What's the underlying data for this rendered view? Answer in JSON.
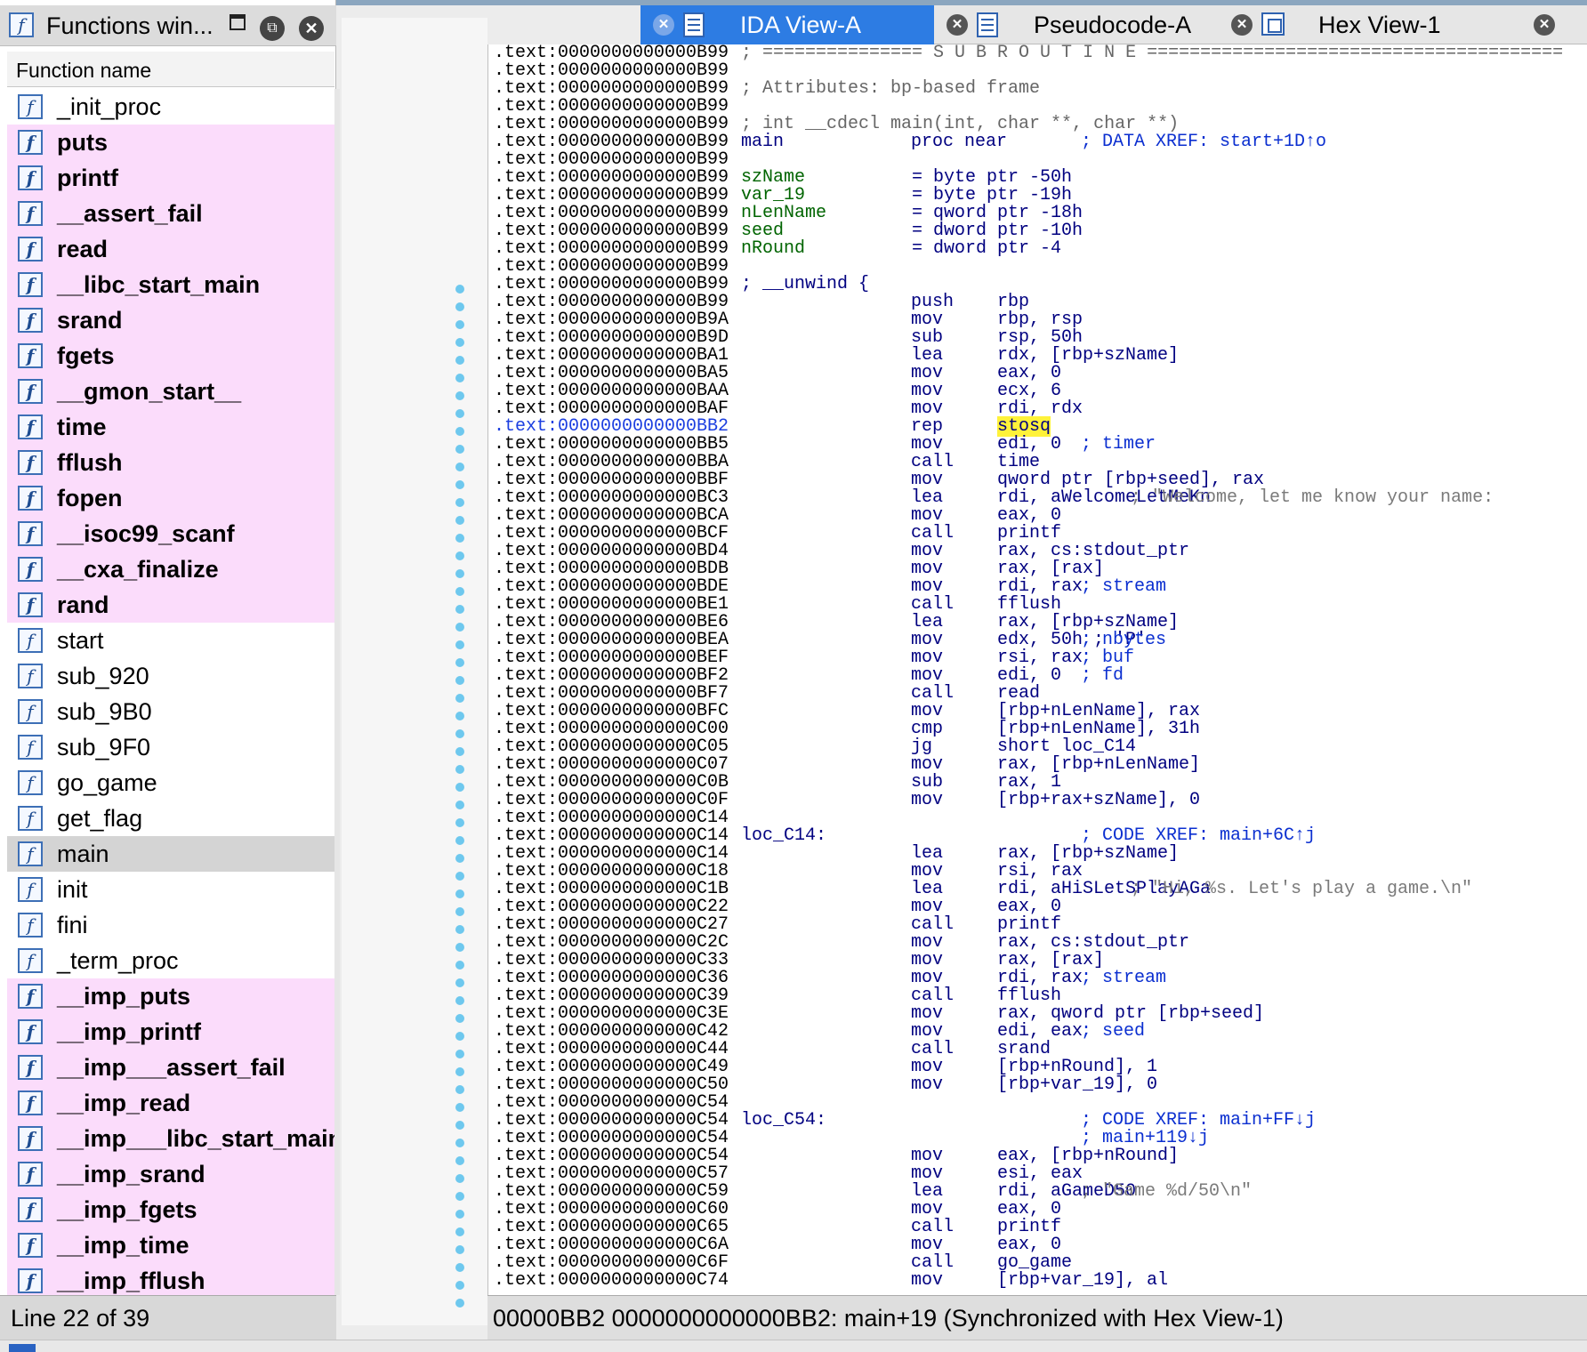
{
  "functions_window": {
    "title": "Functions win...",
    "header": "Function name",
    "status": "Line 22 of 39",
    "items": [
      {
        "name": "_init_proc",
        "lib": false,
        "selected": false
      },
      {
        "name": "puts",
        "lib": true,
        "selected": false
      },
      {
        "name": "printf",
        "lib": true,
        "selected": false
      },
      {
        "name": "__assert_fail",
        "lib": true,
        "selected": false
      },
      {
        "name": "read",
        "lib": true,
        "selected": false
      },
      {
        "name": "__libc_start_main",
        "lib": true,
        "selected": false
      },
      {
        "name": "srand",
        "lib": true,
        "selected": false
      },
      {
        "name": "fgets",
        "lib": true,
        "selected": false
      },
      {
        "name": "__gmon_start__",
        "lib": true,
        "selected": false
      },
      {
        "name": "time",
        "lib": true,
        "selected": false
      },
      {
        "name": "fflush",
        "lib": true,
        "selected": false
      },
      {
        "name": "fopen",
        "lib": true,
        "selected": false
      },
      {
        "name": "__isoc99_scanf",
        "lib": true,
        "selected": false
      },
      {
        "name": "__cxa_finalize",
        "lib": true,
        "selected": false
      },
      {
        "name": "rand",
        "lib": true,
        "selected": false
      },
      {
        "name": "start",
        "lib": false,
        "selected": false
      },
      {
        "name": "sub_920",
        "lib": false,
        "selected": false
      },
      {
        "name": "sub_9B0",
        "lib": false,
        "selected": false
      },
      {
        "name": "sub_9F0",
        "lib": false,
        "selected": false
      },
      {
        "name": "go_game",
        "lib": false,
        "selected": false
      },
      {
        "name": "get_flag",
        "lib": false,
        "selected": false
      },
      {
        "name": "main",
        "lib": false,
        "selected": true
      },
      {
        "name": "init",
        "lib": false,
        "selected": false
      },
      {
        "name": "fini",
        "lib": false,
        "selected": false
      },
      {
        "name": "_term_proc",
        "lib": false,
        "selected": false
      },
      {
        "name": "__imp_puts",
        "lib": true,
        "selected": false
      },
      {
        "name": "__imp_printf",
        "lib": true,
        "selected": false
      },
      {
        "name": "__imp___assert_fail",
        "lib": true,
        "selected": false
      },
      {
        "name": "__imp_read",
        "lib": true,
        "selected": false
      },
      {
        "name": "__imp___libc_start_main",
        "lib": true,
        "selected": false
      },
      {
        "name": "__imp_srand",
        "lib": true,
        "selected": false
      },
      {
        "name": "__imp_fgets",
        "lib": true,
        "selected": false
      },
      {
        "name": "__imp_time",
        "lib": true,
        "selected": false
      },
      {
        "name": "__imp_fflush",
        "lib": true,
        "selected": false
      }
    ]
  },
  "tabs": [
    {
      "label": "IDA View-A",
      "active": true,
      "icon": "ida-view-icon"
    },
    {
      "label": "Pseudocode-A",
      "active": false,
      "icon": "pseudocode-icon"
    },
    {
      "label": "Hex View-1",
      "active": false,
      "icon": "hex-view-icon"
    }
  ],
  "status": "00000BB2  0000000000000BB2: main+19  (Synchronized with Hex View-1)",
  "cursor_token": "stosq",
  "listing": [
    {
      "addr": ".text:0000000000000B99",
      "sep": "; =============== S U B R O U T I N E ======================================="
    },
    {
      "addr": ".text:0000000000000B99"
    },
    {
      "addr": ".text:0000000000000B99",
      "sep": "; Attributes: bp-based frame"
    },
    {
      "addr": ".text:0000000000000B99"
    },
    {
      "addr": ".text:0000000000000B99",
      "sep": "; int __cdecl main(int, char **, char **)"
    },
    {
      "addr": ".text:0000000000000B99",
      "label": "main",
      "mnem": "proc near",
      "cmt": "; DATA XREF: start+1D↑o",
      "cmtcol": 660
    },
    {
      "addr": ".text:0000000000000B99"
    },
    {
      "addr": ".text:0000000000000B99",
      "var": "szName",
      "eq": "= byte ptr -50h"
    },
    {
      "addr": ".text:0000000000000B99",
      "var": "var_19",
      "eq": "= byte ptr -19h"
    },
    {
      "addr": ".text:0000000000000B99",
      "var": "nLenName",
      "eq": "= qword ptr -18h"
    },
    {
      "addr": ".text:0000000000000B99",
      "var": "seed",
      "eq": "= dword ptr -10h"
    },
    {
      "addr": ".text:0000000000000B99",
      "var": "nRound",
      "eq": "= dword ptr -4"
    },
    {
      "addr": ".text:0000000000000B99"
    },
    {
      "addr": ".text:0000000000000B99",
      "label": "; __unwind {"
    },
    {
      "addr": ".text:0000000000000B99",
      "mnem": "push",
      "ops": "rbp"
    },
    {
      "addr": ".text:0000000000000B9A",
      "mnem": "mov",
      "ops": "rbp, rsp"
    },
    {
      "addr": ".text:0000000000000B9D",
      "mnem": "sub",
      "ops": "rsp, 50h"
    },
    {
      "addr": ".text:0000000000000BA1",
      "mnem": "lea",
      "ops": "rdx, [rbp+szName]"
    },
    {
      "addr": ".text:0000000000000BA5",
      "mnem": "mov",
      "ops": "eax, 0"
    },
    {
      "addr": ".text:0000000000000BAA",
      "mnem": "mov",
      "ops": "ecx, 6"
    },
    {
      "addr": ".text:0000000000000BAF",
      "mnem": "mov",
      "ops": "rdi, rdx"
    },
    {
      "addr": ".text:0000000000000BB2",
      "mnem": "rep",
      "ops": "",
      "cursor": true
    },
    {
      "addr": ".text:0000000000000BB5",
      "mnem": "mov",
      "ops": "edi, 0",
      "cmt": "; timer",
      "cmtcol": 660
    },
    {
      "addr": ".text:0000000000000BBA",
      "mnem": "call",
      "ops": "time"
    },
    {
      "addr": ".text:0000000000000BBF",
      "mnem": "mov",
      "ops": "qword ptr [rbp+seed], rax"
    },
    {
      "addr": ".text:0000000000000BC3",
      "mnem": "lea",
      "ops": "rdi, aWelcomeLetMeKn",
      "cmt": "; \"Welcome, let me know your name:",
      "cmtcol": 716,
      "grey": true
    },
    {
      "addr": ".text:0000000000000BCA",
      "mnem": "mov",
      "ops": "eax, 0"
    },
    {
      "addr": ".text:0000000000000BCF",
      "mnem": "call",
      "ops": "printf"
    },
    {
      "addr": ".text:0000000000000BD4",
      "mnem": "mov",
      "ops": "rax, cs:stdout_ptr"
    },
    {
      "addr": ".text:0000000000000BDB",
      "mnem": "mov",
      "ops": "rax, [rax]"
    },
    {
      "addr": ".text:0000000000000BDE",
      "mnem": "mov",
      "ops": "rdi, rax",
      "cmt": "; stream",
      "cmtcol": 660
    },
    {
      "addr": ".text:0000000000000BE1",
      "mnem": "call",
      "ops": "fflush"
    },
    {
      "addr": ".text:0000000000000BE6",
      "mnem": "lea",
      "ops": "rax, [rbp+szName]"
    },
    {
      "addr": ".text:0000000000000BEA",
      "mnem": "mov",
      "ops": "edx, 50h ; 'P'",
      "cmt": "; nbytes",
      "cmtcol": 660
    },
    {
      "addr": ".text:0000000000000BEF",
      "mnem": "mov",
      "ops": "rsi, rax",
      "cmt": "; buf",
      "cmtcol": 660
    },
    {
      "addr": ".text:0000000000000BF2",
      "mnem": "mov",
      "ops": "edi, 0",
      "cmt": "; fd",
      "cmtcol": 660
    },
    {
      "addr": ".text:0000000000000BF7",
      "mnem": "call",
      "ops": "read"
    },
    {
      "addr": ".text:0000000000000BFC",
      "mnem": "mov",
      "ops": "[rbp+nLenName], rax"
    },
    {
      "addr": ".text:0000000000000C00",
      "mnem": "cmp",
      "ops": "[rbp+nLenName], 31h"
    },
    {
      "addr": ".text:0000000000000C05",
      "mnem": "jg",
      "ops": "short loc_C14"
    },
    {
      "addr": ".text:0000000000000C07",
      "mnem": "mov",
      "ops": "rax, [rbp+nLenName]"
    },
    {
      "addr": ".text:0000000000000C0B",
      "mnem": "sub",
      "ops": "rax, 1"
    },
    {
      "addr": ".text:0000000000000C0F",
      "mnem": "mov",
      "ops": "[rbp+rax+szName], 0"
    },
    {
      "addr": ".text:0000000000000C14"
    },
    {
      "addr": ".text:0000000000000C14",
      "label": "loc_C14:",
      "cmt": "; CODE XREF: main+6C↑j",
      "cmtcol": 660
    },
    {
      "addr": ".text:0000000000000C14",
      "mnem": "lea",
      "ops": "rax, [rbp+szName]"
    },
    {
      "addr": ".text:0000000000000C18",
      "mnem": "mov",
      "ops": "rsi, rax"
    },
    {
      "addr": ".text:0000000000000C1B",
      "mnem": "lea",
      "ops": "rdi, aHiSLetSPlayAGa",
      "cmt": "; \"Hi, %s. Let's play a game.\\n\"",
      "cmtcol": 716,
      "grey": true
    },
    {
      "addr": ".text:0000000000000C22",
      "mnem": "mov",
      "ops": "eax, 0"
    },
    {
      "addr": ".text:0000000000000C27",
      "mnem": "call",
      "ops": "printf"
    },
    {
      "addr": ".text:0000000000000C2C",
      "mnem": "mov",
      "ops": "rax, cs:stdout_ptr"
    },
    {
      "addr": ".text:0000000000000C33",
      "mnem": "mov",
      "ops": "rax, [rax]"
    },
    {
      "addr": ".text:0000000000000C36",
      "mnem": "mov",
      "ops": "rdi, rax",
      "cmt": "; stream",
      "cmtcol": 660
    },
    {
      "addr": ".text:0000000000000C39",
      "mnem": "call",
      "ops": "fflush"
    },
    {
      "addr": ".text:0000000000000C3E",
      "mnem": "mov",
      "ops": "rax, qword ptr [rbp+seed]"
    },
    {
      "addr": ".text:0000000000000C42",
      "mnem": "mov",
      "ops": "edi, eax",
      "cmt": "; seed",
      "cmtcol": 660
    },
    {
      "addr": ".text:0000000000000C44",
      "mnem": "call",
      "ops": "srand"
    },
    {
      "addr": ".text:0000000000000C49",
      "mnem": "mov",
      "ops": "[rbp+nRound], 1"
    },
    {
      "addr": ".text:0000000000000C50",
      "mnem": "mov",
      "ops": "[rbp+var_19], 0"
    },
    {
      "addr": ".text:0000000000000C54"
    },
    {
      "addr": ".text:0000000000000C54",
      "label": "loc_C54:",
      "cmt": "; CODE XREF: main+FF↓j",
      "cmtcol": 660
    },
    {
      "addr": ".text:0000000000000C54",
      "cmt": "; main+119↓j",
      "cmtcol": 660
    },
    {
      "addr": ".text:0000000000000C54",
      "mnem": "mov",
      "ops": "eax, [rbp+nRound]"
    },
    {
      "addr": ".text:0000000000000C57",
      "mnem": "mov",
      "ops": "esi, eax"
    },
    {
      "addr": ".text:0000000000000C59",
      "mnem": "lea",
      "ops": "rdi, aGameD50",
      "cmt": "; \"Game %d/50\\n\"",
      "cmtcol": 660,
      "grey": true
    },
    {
      "addr": ".text:0000000000000C60",
      "mnem": "mov",
      "ops": "eax, 0"
    },
    {
      "addr": ".text:0000000000000C65",
      "mnem": "call",
      "ops": "printf"
    },
    {
      "addr": ".text:0000000000000C6A",
      "mnem": "mov",
      "ops": "eax, 0"
    },
    {
      "addr": ".text:0000000000000C6F",
      "mnem": "call",
      "ops": "go_game"
    },
    {
      "addr": ".text:0000000000000C74",
      "mnem": "mov",
      "ops": "[rbp+var_19], al"
    }
  ],
  "colors": {
    "accent": "#2d7ce3",
    "lib_row": "#fbdcfb",
    "selected_row": "#d4d4d4",
    "cursor_highlight": "#fff23a"
  }
}
